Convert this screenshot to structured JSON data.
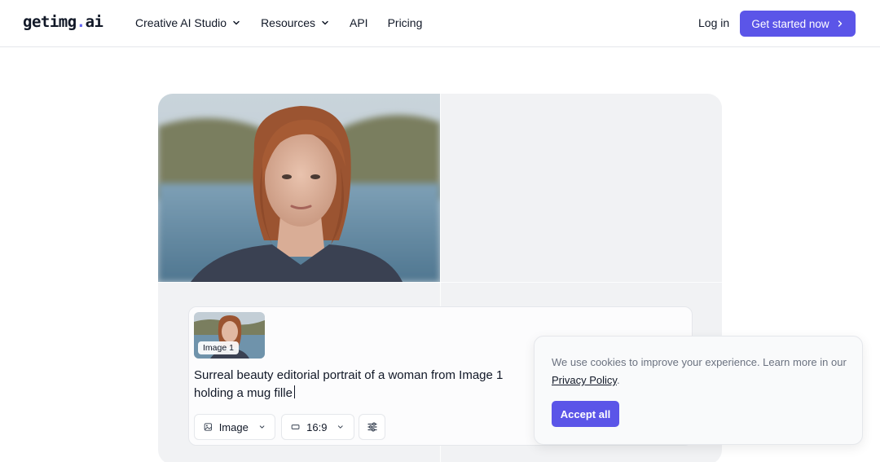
{
  "header": {
    "logo_main": "getimg",
    "logo_dot": ".",
    "logo_tld": "ai",
    "nav": [
      {
        "label": "Creative AI Studio"
      },
      {
        "label": "Resources"
      },
      {
        "label": "API"
      },
      {
        "label": "Pricing"
      }
    ],
    "login_label": "Log in",
    "cta_label": "Get started now"
  },
  "prompt": {
    "image_label": "Image 1",
    "text": "Surreal beauty editorial portrait of a woman from Image 1 holding a mug fille",
    "mode_label": "Image",
    "ratio_label": "16:9"
  },
  "cookie": {
    "text_before": "We use cookies to improve your experience. Learn more in our ",
    "link_label": "Privacy Policy",
    "text_after": ".",
    "accept_label": "Accept all"
  },
  "colors": {
    "accent": "#5b55e8",
    "border": "#e5e7eb",
    "muted_text": "#6b7280"
  }
}
